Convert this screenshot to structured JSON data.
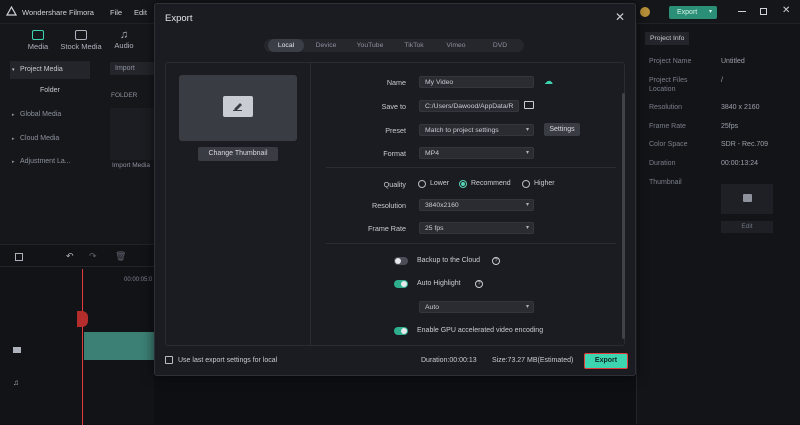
{
  "app": {
    "brand": "Wondershare Filmora",
    "menu": [
      "File",
      "Edit"
    ],
    "export_button": "Export"
  },
  "left_panel": {
    "tabs": [
      {
        "label": "Media",
        "icon": "media-icon"
      },
      {
        "label": "Stock Media",
        "icon": "stock-media-icon"
      },
      {
        "label": "Audio",
        "icon": "music-note-icon"
      }
    ],
    "items": [
      "Project Media",
      "Folder",
      "Global Media",
      "Cloud Media",
      "Adjustment La..."
    ],
    "import_label": "Import",
    "folder_header": "FOLDER",
    "import_media": "Import Media"
  },
  "right_panel": {
    "tab": "Project Info",
    "rows": [
      {
        "key": "Project Name",
        "value": "Untitled"
      },
      {
        "key": "Project Files Location",
        "value": "/"
      },
      {
        "key": "Resolution",
        "value": "3840 x 2160"
      },
      {
        "key": "Frame Rate",
        "value": "25fps"
      },
      {
        "key": "Color Space",
        "value": "SDR - Rec.709"
      },
      {
        "key": "Duration",
        "value": "00:00:13:24"
      },
      {
        "key": "Thumbnail",
        "value": ""
      }
    ],
    "edit_label": "Edit"
  },
  "timeline": {
    "timecode": "00:00:05:0"
  },
  "dialog": {
    "title": "Export",
    "tabs": [
      "Local",
      "Device",
      "YouTube",
      "TikTok",
      "Vimeo",
      "DVD"
    ],
    "change_thumbnail": "Change Thumbnail",
    "fields": {
      "name_label": "Name",
      "name_value": "My Video",
      "save_to_label": "Save to",
      "save_to_value": "C:/Users/Dawood/AppData/R",
      "preset_label": "Preset",
      "preset_value": "Match to project settings",
      "settings_button": "Settings",
      "format_label": "Format",
      "format_value": "MP4",
      "quality_label": "Quality",
      "quality_options": [
        "Lower",
        "Recommend",
        "Higher"
      ],
      "quality_selected": "Recommend",
      "resolution_label": "Resolution",
      "resolution_value": "3840x2160",
      "frame_rate_label": "Frame Rate",
      "frame_rate_value": "25 fps",
      "backup_label": "Backup to the Cloud",
      "auto_highlight_label": "Auto Highlight",
      "auto_value": "Auto",
      "gpu_label": "Enable GPU accelerated video encoding"
    },
    "footer": {
      "use_last": "Use last export settings for local",
      "duration": "Duration:00:00:13",
      "size": "Size:73.27 MB(Estimated)",
      "export_button": "Export"
    }
  },
  "colors": {
    "accent": "#3dd5b0",
    "highlight_border": "#e33b3b",
    "modal_bg": "#1b1c21"
  }
}
